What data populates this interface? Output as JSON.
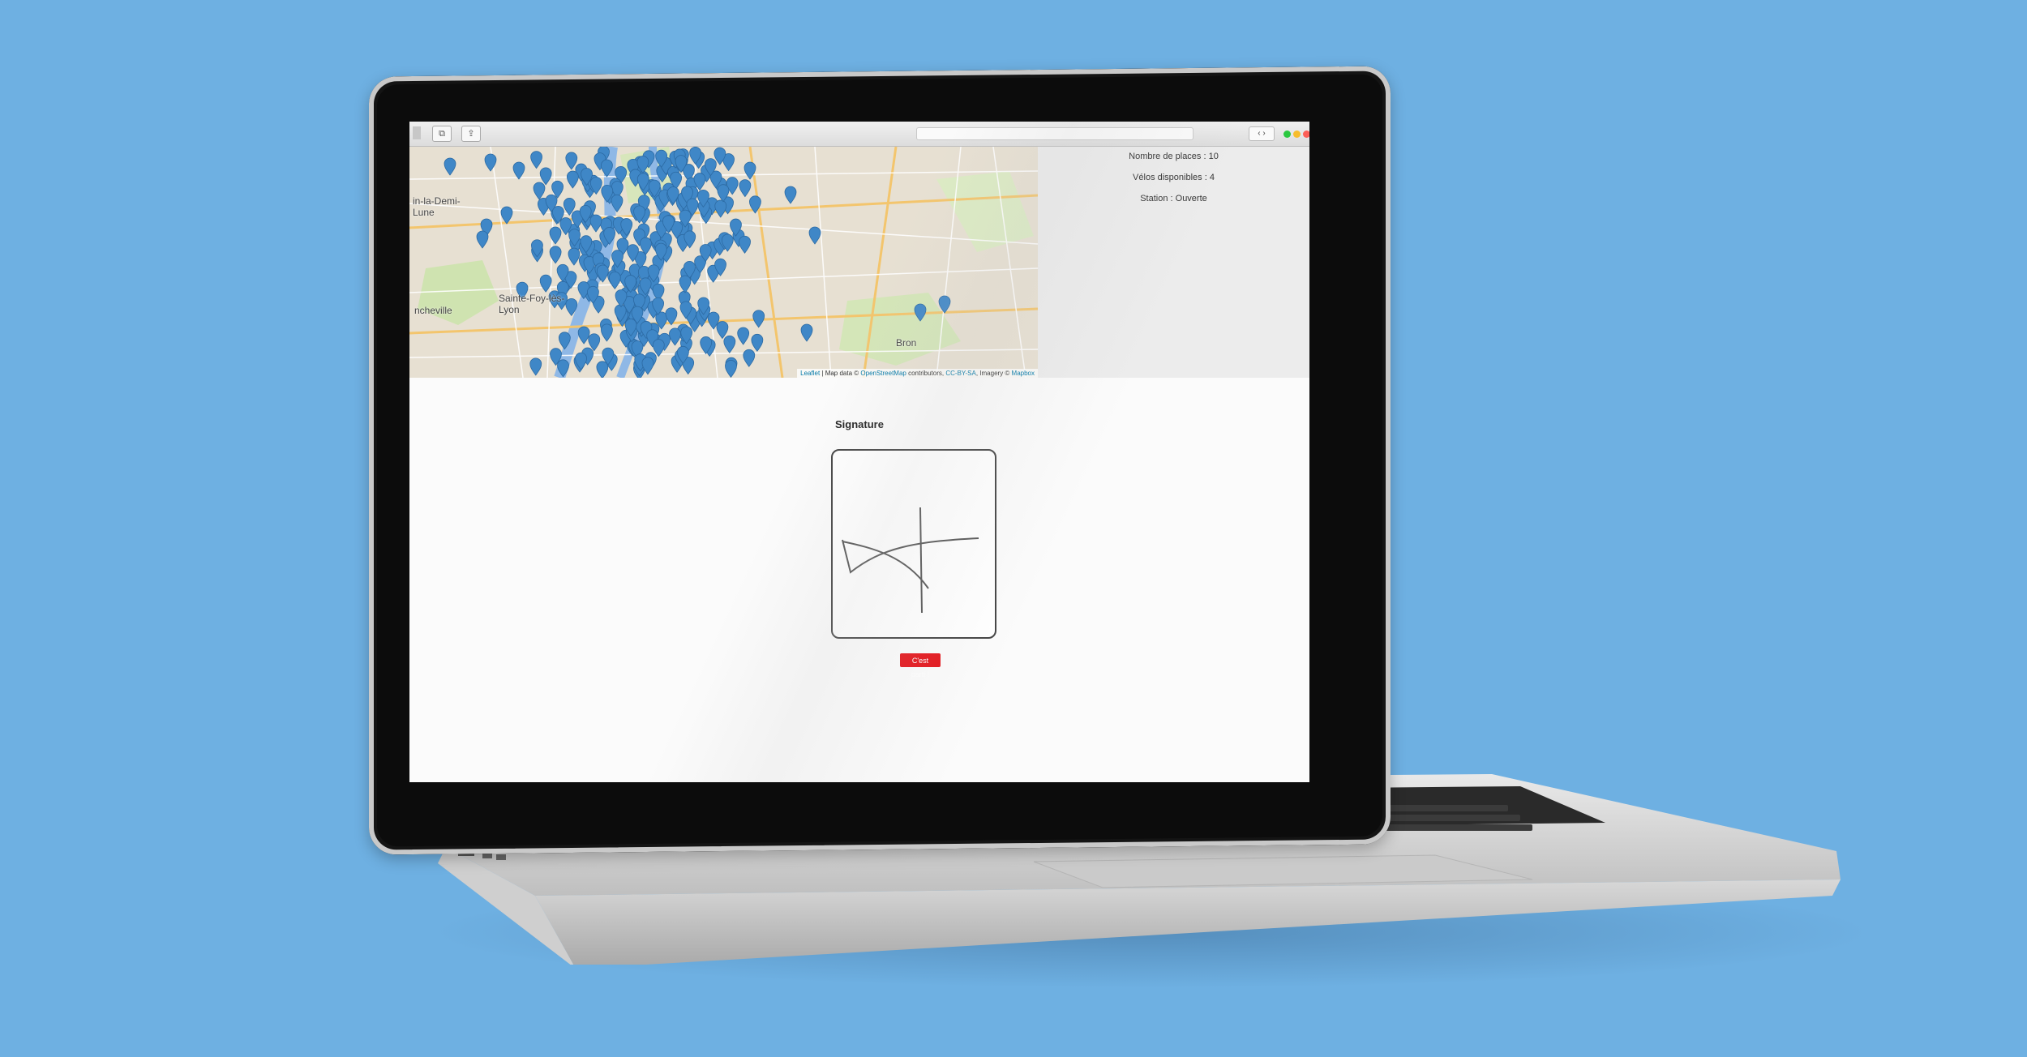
{
  "map": {
    "labels": [
      "in-la-Demi-\nLune",
      "Sainte-Foy-lès-\nLyon",
      "ncheville",
      "Bron"
    ],
    "attribution": {
      "leaflet": "Leaflet",
      "text1": " | Map data © ",
      "osm": "OpenStreetMap",
      "text2": " contributors, ",
      "license": "CC-BY-SA",
      "text3": ", Imagery © ",
      "mapbox": "Mapbox"
    }
  },
  "station": {
    "places": "Nombre de places : 10",
    "bikes": "Vélos disponibles : 4",
    "status": "Station : Ouverte"
  },
  "signature": {
    "title": "Signature",
    "button": "C'est parti !"
  },
  "colors": {
    "background": "#6eb0e2",
    "marker": "#3f87c7",
    "button": "#e4151b"
  },
  "icons": {
    "map_marker": "map-pin-icon",
    "traffic_lights": "window-controls"
  }
}
